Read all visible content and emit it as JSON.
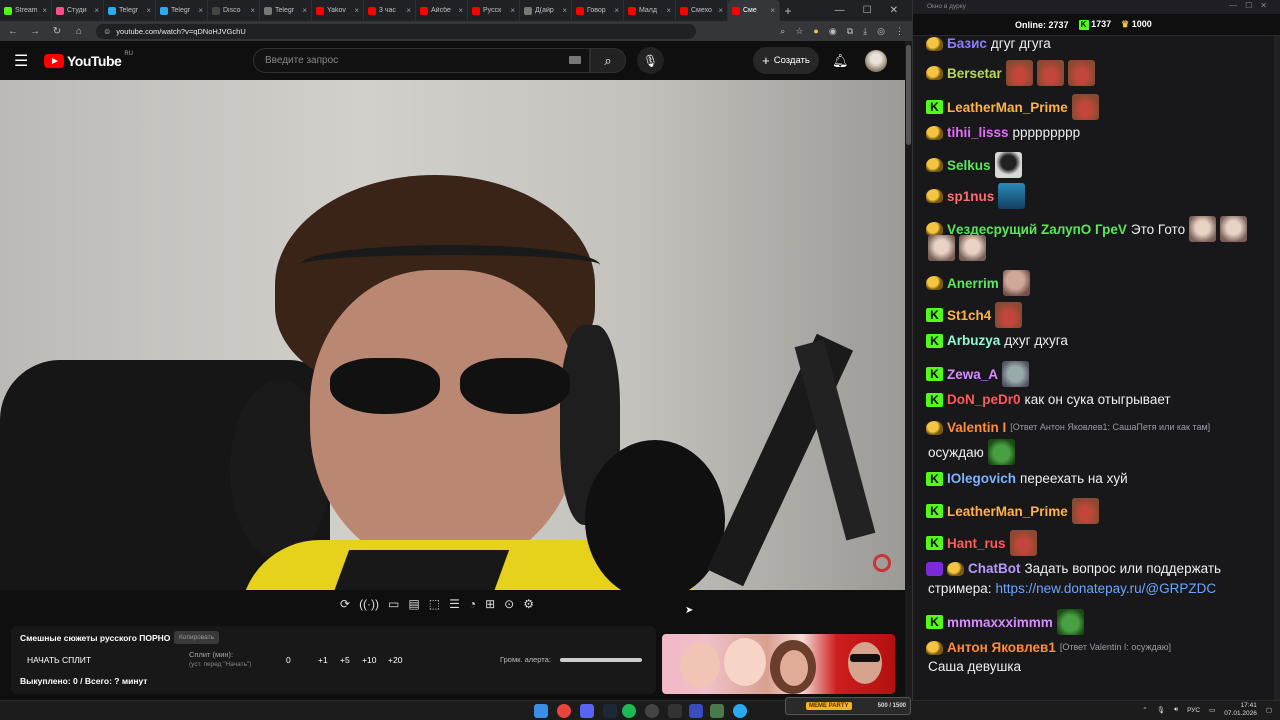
{
  "browser": {
    "tabs": [
      {
        "label": "Stream",
        "color": "#53fc18"
      },
      {
        "label": "Студи",
        "color": "#ff4e8a"
      },
      {
        "label": "Telegr",
        "color": "#2aabee"
      },
      {
        "label": "Telegr",
        "color": "#2aabee"
      },
      {
        "label": "Disco",
        "color": "#444"
      },
      {
        "label": "Telegr",
        "color": "#777"
      },
      {
        "label": "Yakov",
        "color": "#ff0000"
      },
      {
        "label": "3 час",
        "color": "#ff0000"
      },
      {
        "label": "Айсбе",
        "color": "#ff0000"
      },
      {
        "label": "Русск",
        "color": "#ff0000"
      },
      {
        "label": "Д(айр",
        "color": "#777"
      },
      {
        "label": "Говор",
        "color": "#ff0000"
      },
      {
        "label": "Малд",
        "color": "#ff0000"
      },
      {
        "label": "Смехо",
        "color": "#ff0000"
      },
      {
        "label": "Сме",
        "color": "#ff0000"
      }
    ],
    "url": "youtube.com/watch?v=qDNoHJVGchU"
  },
  "youtube": {
    "logo": "YouTube",
    "region": "RU",
    "search_placeholder": "Введите запрос",
    "create_label": "Создать"
  },
  "extension": {
    "title": "Смешные сюжеты русского ПОРНО",
    "copy_label": "Копировать",
    "start_split": "НАЧАТЬ СПЛИТ",
    "split_label": "Сплит (мин):",
    "split_hint": "(уст. перед \"Начать\")",
    "split_value": "0",
    "add_buttons": [
      "+1",
      "+5",
      "+10",
      "+20"
    ],
    "volume_label": "Громк. алерта:",
    "volume_level": 1.0,
    "bought": "Выкуплено: 0 / Всего: ? минут"
  },
  "chat": {
    "window_title": "Окно в дурку",
    "online_label": "Online:",
    "online_count": "2737",
    "kick_count": "1737",
    "crown_count": "1000",
    "messages": [
      {
        "badge": "crown",
        "user": "Базис",
        "color": "#8a7fff",
        "text": "дгуг дгуга"
      },
      {
        "badge": "crown",
        "user": "Bersetar",
        "color": "#bada55",
        "text": ""
      },
      {
        "badge": "kick",
        "user": "LeatherMan_Prime",
        "color": "#ffb347",
        "text": ""
      },
      {
        "badge": "crown",
        "user": "tihii_lisss",
        "color": "#e66bff",
        "text": "ррррррррр"
      },
      {
        "badge": "crown",
        "user": "Selkus",
        "color": "#5ce65c",
        "text": ""
      },
      {
        "badge": "crown",
        "user": "sp1nus",
        "color": "#ff6e6e",
        "text": ""
      },
      {
        "badge": "crown",
        "user": "Vездесрущий ZалупО ГреV",
        "color": "#5ce65c",
        "text": "Это Гото"
      },
      {
        "badge": "crown",
        "user": "Anerrim",
        "color": "#5ce65c",
        "text": ""
      },
      {
        "badge": "kick",
        "user": "St1ch4",
        "color": "#ffb347",
        "text": ""
      },
      {
        "badge": "kick",
        "user": "Arbuzya",
        "color": "#93f7d3",
        "text": "дхуг дхуга"
      },
      {
        "badge": "kick",
        "user": "Zewa_A",
        "color": "#d78bff",
        "text": ""
      },
      {
        "badge": "kick",
        "user": "DoN_peDr0",
        "color": "#ff5a5a",
        "text": "как он сука отыгрывает"
      },
      {
        "badge": "crown",
        "user": "Valentin I",
        "color": "#ff8c3a",
        "reply": "[Ответ Антон Яковлев1: СашаПетя или как там]",
        "text": "осуждаю"
      },
      {
        "badge": "kick",
        "user": "IOlegovich",
        "color": "#7fb2ff",
        "text": "переехать на хуй"
      },
      {
        "badge": "kick",
        "user": "LeatherMan_Prime",
        "color": "#ffb347",
        "text": ""
      },
      {
        "badge": "kick",
        "user": "Hant_rus",
        "color": "#ff5a5a",
        "text": ""
      },
      {
        "badge": "bot",
        "user": "ChatBot",
        "color": "#b799ff",
        "text": "Задать вопрос или поддержать",
        "text2": "стримера:",
        "link": "https://new.donatepay.ru/@GRPZDC"
      },
      {
        "badge": "kick",
        "user": "mmmaxxximmm",
        "color": "#d78bff",
        "text": ""
      },
      {
        "badge": "crown",
        "user": "Антон Яковлев1",
        "color": "#ff8c3a",
        "reply": "[Ответ Valentin I: осуждаю]",
        "text": "Саша девушка"
      }
    ]
  },
  "taskbar": {
    "meme_label": "MEME PARTY",
    "meme_count": "500 / 1500",
    "lang": "РУС",
    "time": "17:41",
    "date": "07.01.2026"
  }
}
